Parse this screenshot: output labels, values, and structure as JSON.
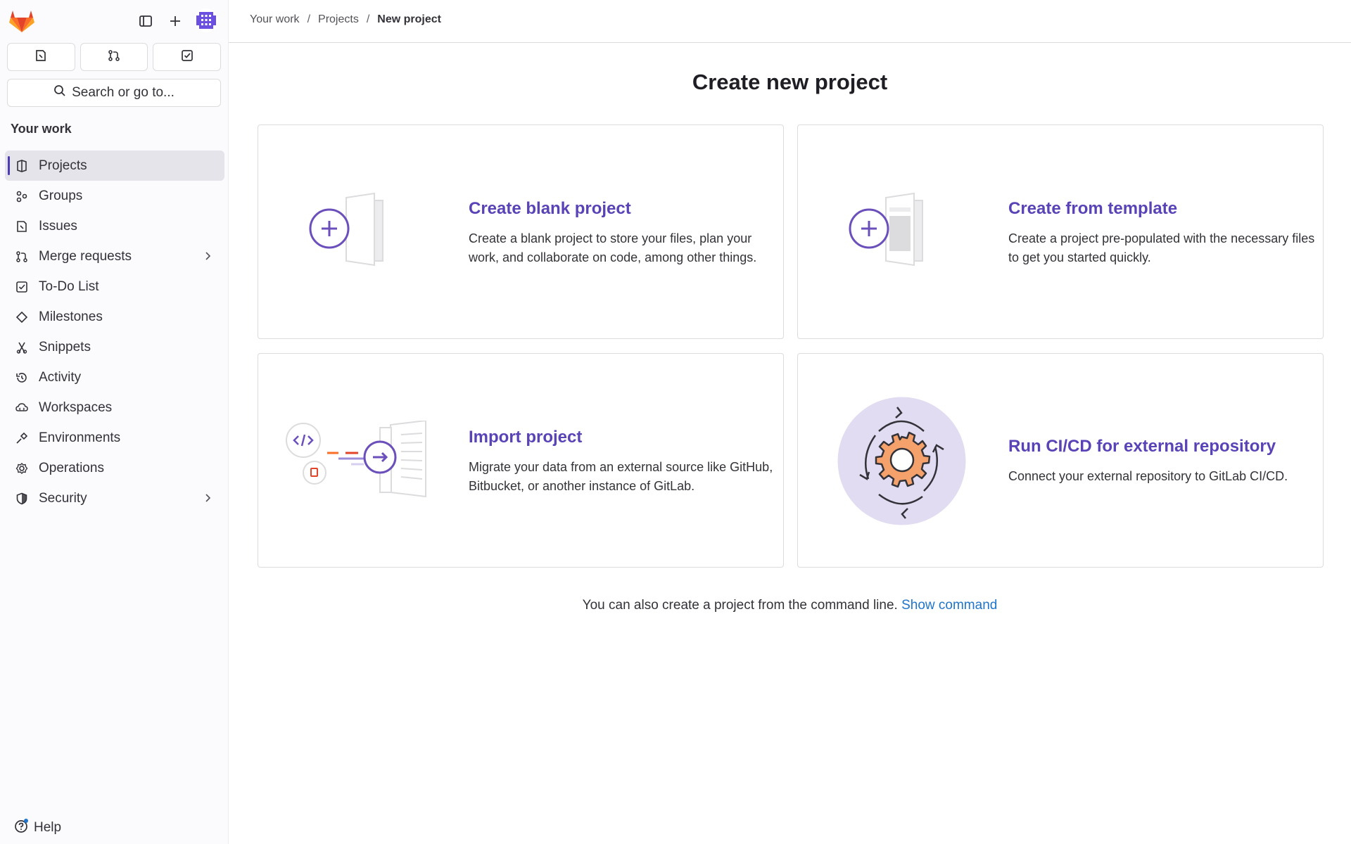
{
  "sidebar": {
    "search_label": "Search or go to...",
    "section_title": "Your work",
    "items": [
      {
        "label": "Projects",
        "icon": "project-icon",
        "active": true
      },
      {
        "label": "Groups",
        "icon": "group-icon"
      },
      {
        "label": "Issues",
        "icon": "issues-icon"
      },
      {
        "label": "Merge requests",
        "icon": "merge-request-icon",
        "has_chevron": true
      },
      {
        "label": "To-Do List",
        "icon": "todo-icon"
      },
      {
        "label": "Milestones",
        "icon": "milestone-icon"
      },
      {
        "label": "Snippets",
        "icon": "snippet-icon"
      },
      {
        "label": "Activity",
        "icon": "history-icon"
      },
      {
        "label": "Workspaces",
        "icon": "workspace-icon"
      },
      {
        "label": "Environments",
        "icon": "environment-icon"
      },
      {
        "label": "Operations",
        "icon": "operations-icon"
      },
      {
        "label": "Security",
        "icon": "shield-icon",
        "has_chevron": true
      }
    ],
    "help_label": "Help"
  },
  "breadcrumb": {
    "items": [
      "Your work",
      "Projects",
      "New project"
    ]
  },
  "page": {
    "title": "Create new project"
  },
  "cards": [
    {
      "title": "Create blank project",
      "description": "Create a blank project to store your files, plan your work, and collaborate on code, among other things."
    },
    {
      "title": "Create from template",
      "description": "Create a project pre-populated with the necessary files to get you started quickly."
    },
    {
      "title": "Import project",
      "description": "Migrate your data from an external source like GitHub, Bitbucket, or another instance of GitLab."
    },
    {
      "title": "Run CI/CD for external repository",
      "description": "Connect your external repository to GitLab CI/CD."
    }
  ],
  "footer": {
    "text": "You can also create a project from the command line.",
    "link_label": "Show command"
  },
  "colors": {
    "accent": "#5943b6",
    "link": "#1f75cb",
    "active_indicator": "#4c3bb8",
    "logo_orange": "#e24329"
  }
}
